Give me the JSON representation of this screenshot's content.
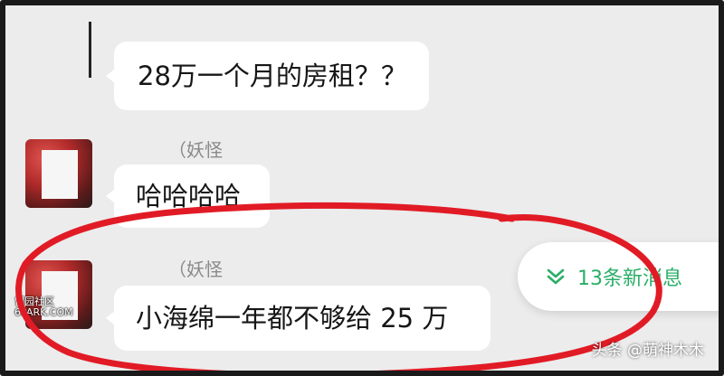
{
  "messages": [
    {
      "sender": "",
      "text": "28万一个月的房租？？"
    },
    {
      "sender": "（妖怪",
      "text": "哈哈哈哈"
    },
    {
      "sender": "（妖怪",
      "text": "小海绵一年都不够给 25 万"
    }
  ],
  "new_messages": {
    "label": "13条新消息",
    "icon": "double-chevron-down-icon"
  },
  "watermark": {
    "line1": "留园社区",
    "line2": "6PARK.COM"
  },
  "credit": "头条 @萌神木木",
  "colors": {
    "accent": "#2aae67",
    "annotation": "#e11b25",
    "background": "#ececec",
    "bubble": "#ffffff"
  }
}
